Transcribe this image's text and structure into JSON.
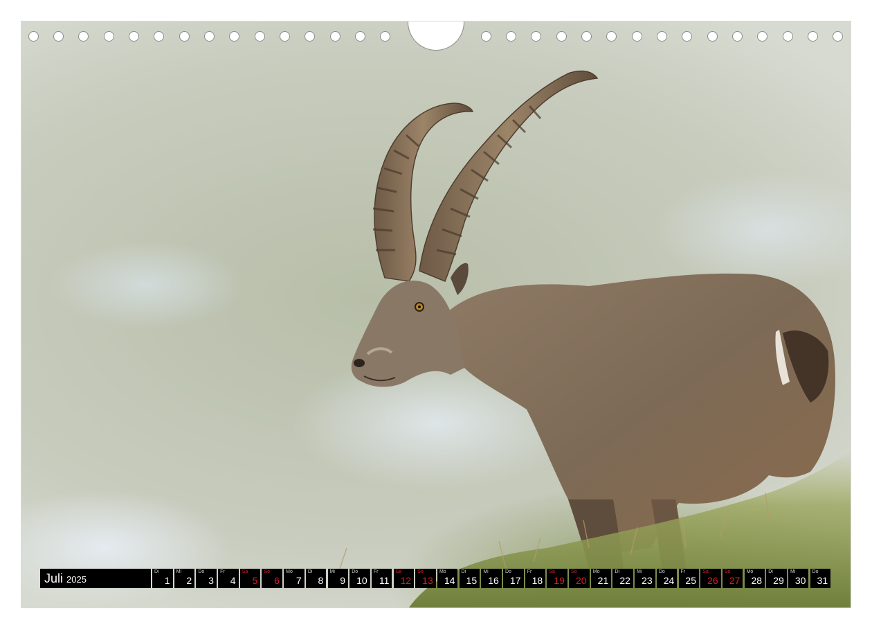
{
  "calendar": {
    "month": "Juli",
    "year": "2025",
    "days": [
      {
        "wd": "Di",
        "num": "1",
        "weekend": false
      },
      {
        "wd": "Mi",
        "num": "2",
        "weekend": false
      },
      {
        "wd": "Do",
        "num": "3",
        "weekend": false
      },
      {
        "wd": "Fr",
        "num": "4",
        "weekend": false
      },
      {
        "wd": "Sa",
        "num": "5",
        "weekend": true
      },
      {
        "wd": "So",
        "num": "6",
        "weekend": true
      },
      {
        "wd": "Mo",
        "num": "7",
        "weekend": false
      },
      {
        "wd": "Di",
        "num": "8",
        "weekend": false
      },
      {
        "wd": "Mi",
        "num": "9",
        "weekend": false
      },
      {
        "wd": "Do",
        "num": "10",
        "weekend": false
      },
      {
        "wd": "Fr",
        "num": "11",
        "weekend": false
      },
      {
        "wd": "Sa",
        "num": "12",
        "weekend": true
      },
      {
        "wd": "So",
        "num": "13",
        "weekend": true
      },
      {
        "wd": "Mo",
        "num": "14",
        "weekend": false
      },
      {
        "wd": "Di",
        "num": "15",
        "weekend": false
      },
      {
        "wd": "Mi",
        "num": "16",
        "weekend": false
      },
      {
        "wd": "Do",
        "num": "17",
        "weekend": false
      },
      {
        "wd": "Fr",
        "num": "18",
        "weekend": false
      },
      {
        "wd": "Sa",
        "num": "19",
        "weekend": true
      },
      {
        "wd": "So",
        "num": "20",
        "weekend": true
      },
      {
        "wd": "Mo",
        "num": "21",
        "weekend": false
      },
      {
        "wd": "Di",
        "num": "22",
        "weekend": false
      },
      {
        "wd": "Mi",
        "num": "23",
        "weekend": false
      },
      {
        "wd": "Do",
        "num": "24",
        "weekend": false
      },
      {
        "wd": "Fr",
        "num": "25",
        "weekend": false
      },
      {
        "wd": "Sa",
        "num": "26",
        "weekend": true
      },
      {
        "wd": "So",
        "num": "27",
        "weekend": true
      },
      {
        "wd": "Mo",
        "num": "28",
        "weekend": false
      },
      {
        "wd": "Di",
        "num": "29",
        "weekend": false
      },
      {
        "wd": "Mi",
        "num": "30",
        "weekend": false
      },
      {
        "wd": "Do",
        "num": "31",
        "weekend": false
      }
    ]
  },
  "colors": {
    "bar_background": "#000000",
    "weekday_text": "#ffffff",
    "weekend_text": "#d0202a"
  },
  "photo": {
    "subject_icon": "alpine-ibex-illustration"
  }
}
